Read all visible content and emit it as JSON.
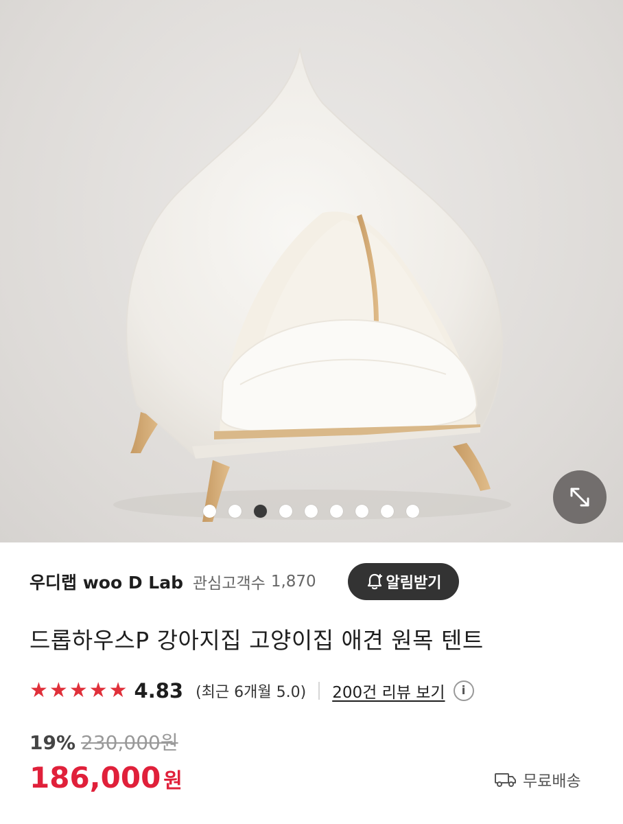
{
  "gallery": {
    "total_images": 9,
    "active_index": 2
  },
  "seller": {
    "name": "우디랩 woo D Lab",
    "fans_label": "관심고객수",
    "fans_count": "1,870",
    "notify_label": "알림받기"
  },
  "product": {
    "title": "드롭하우스P 강아지집 고양이집 애견 원목 텐트"
  },
  "rating": {
    "stars": 5,
    "score": "4.83",
    "recent": "(최근 6개월 5.0)",
    "review_link": "200건 리뷰 보기"
  },
  "pricing": {
    "discount_rate": "19%",
    "original_price": "230,000원",
    "sale_price": "186,000",
    "currency": "원"
  },
  "shipping": {
    "label": "무료배송"
  },
  "colors": {
    "accent_red": "#e0203a",
    "star_red": "#e0303a",
    "notify_bg": "#333333"
  }
}
